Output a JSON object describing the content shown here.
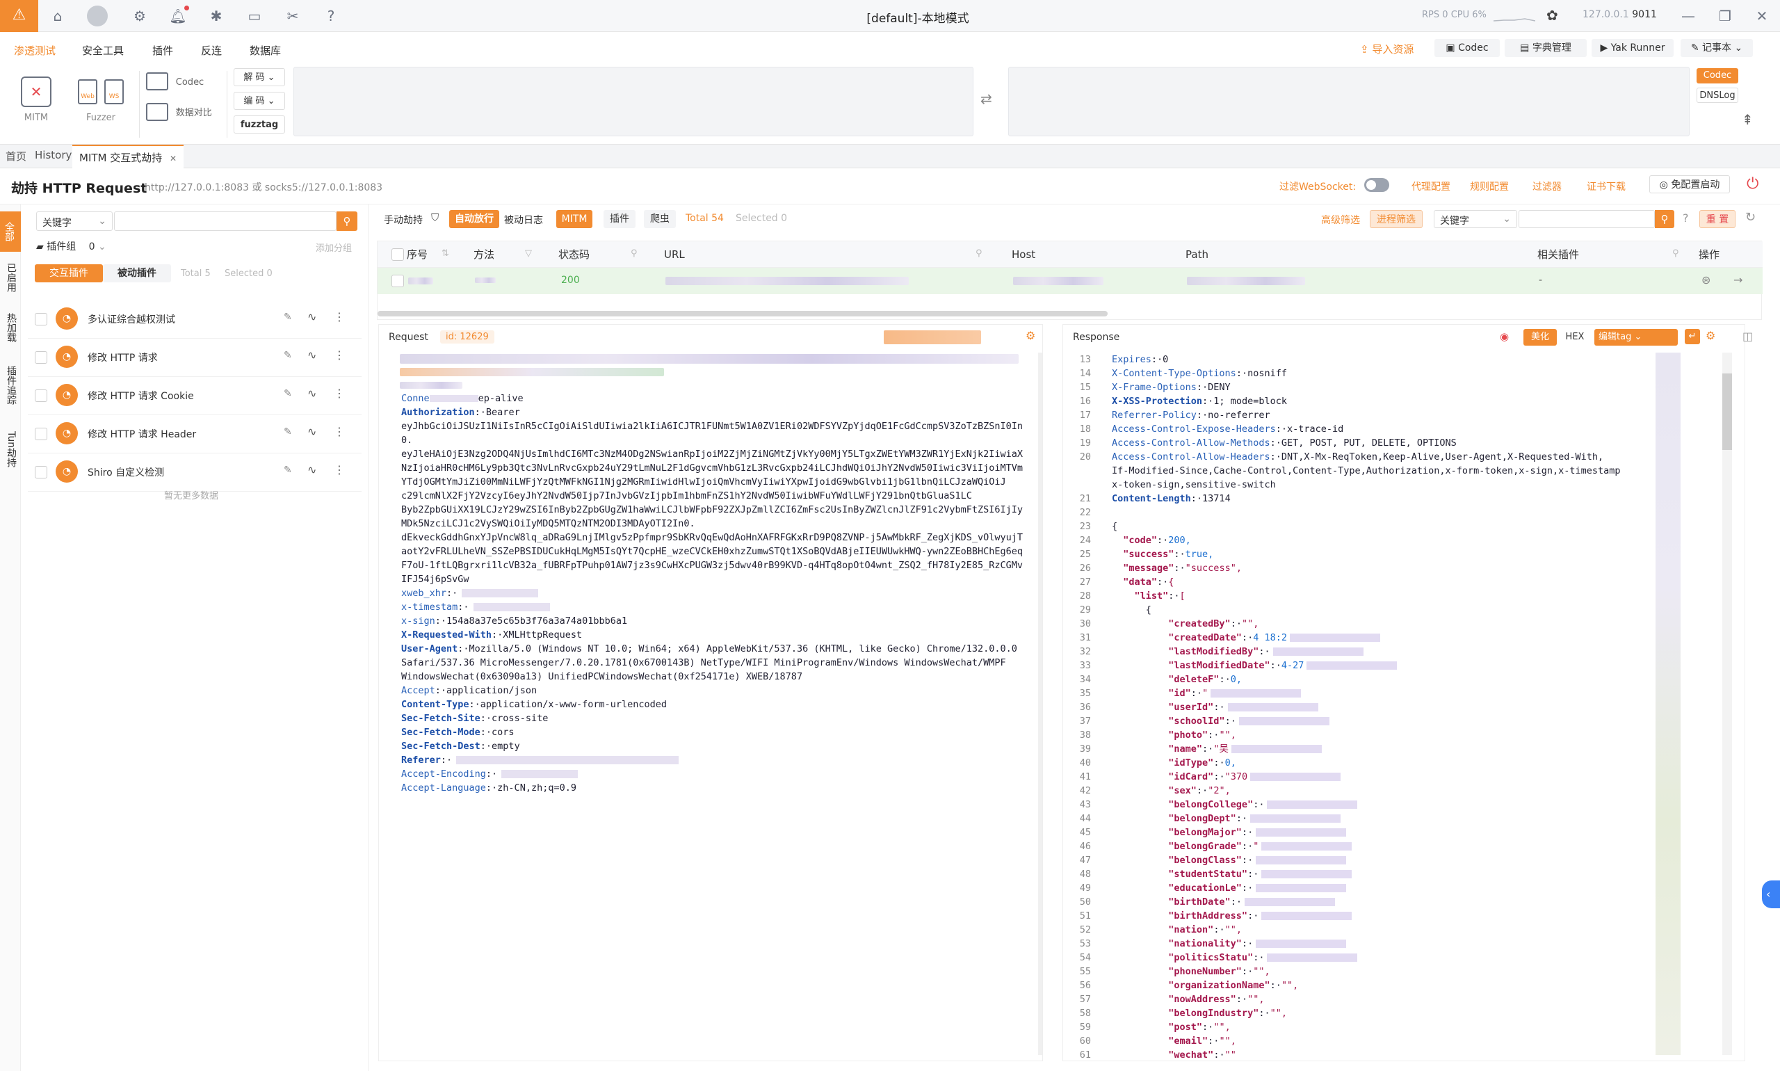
{
  "title": "[default]-本地模式",
  "status": {
    "rps_label": "RPS",
    "rps": "0",
    "cpu_label": "CPU",
    "cpu": "6%",
    "addr": "127.0.0.1",
    "port": "9011"
  },
  "menu": [
    "渗透测试",
    "安全工具",
    "插件",
    "反连",
    "数据库"
  ],
  "right_menu": {
    "import": "导入资源",
    "codec": "Codec",
    "dict": "字典管理",
    "yak": "Yak Runner",
    "notebook": "记事本"
  },
  "tools": {
    "mitm": "MITM",
    "fuzzer": "Fuzzer",
    "codec": "Codec",
    "compare": "数据对比",
    "decode": "解 码",
    "encode": "编 码",
    "fuzztag": "fuzztag",
    "codec_right": "Codec",
    "dnslog": "DNSLog"
  },
  "tabs": [
    "首页",
    "History",
    "MITM 交互式劫持"
  ],
  "header": {
    "title": "劫持 HTTP Request",
    "addr": "http://127.0.0.1:8083 或 socks5://127.0.0.1:8083",
    "filter_ws": "过滤WebSocket:",
    "proxy": "代理配置",
    "rules": "规则配置",
    "filter": "过滤器",
    "cert": "证书下载",
    "autostart": "免配置启动"
  },
  "side_tabs": [
    "全部",
    "已启用",
    "热加载",
    "插件追踪",
    "Tun劫持"
  ],
  "left": {
    "search_mode": "关键字",
    "group_label": "插件组",
    "group_count": "0",
    "add_group": "添加分组",
    "tab_active": "交互插件",
    "tab_passive": "被动插件",
    "total": "Total 5",
    "selected": "Selected 0",
    "empty": "暂无更多数据",
    "plugins": [
      "多认证综合越权测试",
      "修改 HTTP 请求",
      "修改 HTTP 请求 Cookie",
      "修改 HTTP 请求 Header",
      "Shiro 自定义检测"
    ]
  },
  "table": {
    "manual": "手动劫持",
    "auto": "自动放行",
    "log": "被动日志",
    "mitm": "MITM",
    "plugin": "插件",
    "crawler": "爬虫",
    "total": "Total 54",
    "selected": "Selected 0",
    "adv": "高级筛选",
    "proc": "进程筛选",
    "keyword": "关键字",
    "reset": "重 置",
    "cols": [
      "序号",
      "方法",
      "状态码",
      "URL",
      "Host",
      "Path",
      "相关插件",
      "操作"
    ],
    "row_status": "200",
    "row_plugin": "-"
  },
  "request": {
    "label": "Request",
    "id": "id: 12629",
    "lines": [
      [
        "",
        "Conne",
        "ep-alive"
      ],
      [
        "k",
        "Authorization",
        "Bearer"
      ],
      [
        "t",
        "",
        "eyJhbGciOiJSUzI1NiIsInR5cCIgOiAiSldUIiwia2lkIiA6ICJTR1FUNmt5W1A0ZV1ERi02WDFSYVZpYjdqOE1FcGdCcmpSV3ZoTzBZSnI0In"
      ],
      [
        "t",
        "",
        "0."
      ],
      [
        "t",
        "",
        "eyJleHAiOjE3Nzg2ODQ4NjUsImlhdCI6MTc3NzM4ODg2NSwianRpIjoiM2ZjMjZiNGMtZjVkYy00MjY5LTgxZWEtYWM3ZWR1YjExNjk2IiwiaX"
      ],
      [
        "t",
        "",
        "NzIjoiaHR0cHM6Ly9pb3Qtc3NvLnRvcGxpb24uY29tLmNuL2F1dGgvcmVhbG1zL3RvcGxpb24iLCJhdWQiOiJhY2NvdW50Iiwic3ViIjoiMTVm"
      ],
      [
        "t",
        "",
        "YTdjOGMtYmJiZi00MmNiLWFjYzQtMWFkNGI1Njg2MGRmIiwidHlwIjoiQmVhcmVyIiwiYXpwIjoidG9wbGlvbi1jbG1lbnQiLCJzaWQiOiJ"
      ],
      [
        "t",
        "",
        "c29lcmNlX2FjY2VzcyI6eyJhY2NvdW50Ijp7InJvbGVzIjpbIm1hbmFnZS1hY2NvdW50IiwibWFuYWdlLWFjY291bnQtbGluaS1LC"
      ],
      [
        "t",
        "",
        "Byb2ZpbGUiXX19LCJzY29wZSI6InByb2ZpbGUgZW1haWwiLCJlbWFpbF92ZXJpZmllZCI6ZmFsc2UsInByZWZlcnJlZF91c2VybmFtZSI6IjIy"
      ],
      [
        "t",
        "",
        "MDk5NzciLCJ1c2VySWQiOiIyMDQ5MTQzNTM2ODI3MDAyOTI2In0."
      ],
      [
        "t",
        "",
        "dEkveckGddhGnxYJpVncW8lq_aDRaG9LnjIMlgv5zPpfmpr9SbKRvQqEwQdAoHnXAFRFGKxRrD9PQ8ZVNP-j5AwMbkRF_ZegXjKDS_vOlwyujT"
      ],
      [
        "t",
        "",
        "aotY2vFRLULheVN_SSZePBSIDUCukHqLMgM5IsQYt7QcpHE_wzeCVCkEH0xhzZumwSTQt1XSoBQVdABjeIIEUWUwkHWQ-ywn2ZEoBBHChEg6eq"
      ],
      [
        "t",
        "",
        "F7oU-1ftLQBgrxri1lcVB32a_fUBRFpTPuhp01AW7jz3s9CwHXcPUGW3zj5dwv40rB99KVD-q4HTq8opOtO4wnt_ZSQ2_fH78Iy2E85_RzCGMv"
      ],
      [
        "t",
        "",
        "IFJ54j6pSvGw"
      ],
      [
        "n",
        "xweb_xhr",
        ""
      ],
      [
        "n",
        "x-timestam",
        ""
      ],
      [
        "n",
        "x-sign",
        "154a8a37e5c65b3f76a3a74a01bbb6a1"
      ],
      [
        "k",
        "X-Requested-With",
        "XMLHttpRequest"
      ],
      [
        "k",
        "User-Agent",
        "Mozilla/5.0 (Windows NT 10.0; Win64; x64) AppleWebKit/537.36 (KHTML, like Gecko) Chrome/132.0.0.0"
      ],
      [
        "t",
        "",
        "Safari/537.36 MicroMessenger/7.0.20.1781(0x6700143B) NetType/WIFI MiniProgramEnv/Windows WindowsWechat/WMPF"
      ],
      [
        "t",
        "",
        "WindowsWechat(0x63090a13) UnifiedPCWindowsWechat(0xf254171e) XWEB/18787"
      ],
      [
        "n",
        "Accept",
        "application/json"
      ],
      [
        "k",
        "Content-Type",
        "application/x-www-form-urlencoded"
      ],
      [
        "k",
        "Sec-Fetch-Site",
        "cross-site"
      ],
      [
        "k",
        "Sec-Fetch-Mode",
        "cors"
      ],
      [
        "k",
        "Sec-Fetch-Dest",
        "empty"
      ],
      [
        "k",
        "Referer",
        ""
      ],
      [
        "n",
        "Accept-Encoding",
        ""
      ],
      [
        "n",
        "Accept-Language",
        "zh-CN,zh;q=0.9"
      ]
    ]
  },
  "response": {
    "label": "Response",
    "beautify": "美化",
    "hex": "HEX",
    "edit_tag": "编辑tag",
    "lines": [
      [
        "13",
        "h",
        "Expires",
        "0"
      ],
      [
        "14",
        "h",
        "X-Content-Type-Options",
        "nosniff"
      ],
      [
        "15",
        "h",
        "X-Frame-Options",
        "DENY"
      ],
      [
        "16",
        "hb",
        "X-XSS-Protection",
        "1; mode=block"
      ],
      [
        "17",
        "h",
        "Referrer-Policy",
        "no-referrer"
      ],
      [
        "18",
        "h",
        "Access-Control-Expose-Headers",
        "x-trace-id"
      ],
      [
        "19",
        "h",
        "Access-Control-Allow-Methods",
        "GET, POST, PUT, DELETE, OPTIONS"
      ],
      [
        "20",
        "h",
        "Access-Control-Allow-Headers",
        "DNT,X-Mx-ReqToken,Keep-Alive,User-Agent,X-Requested-With,"
      ],
      [
        "",
        "t",
        "",
        "If-Modified-Since,Cache-Control,Content-Type,Authorization,x-form-token,x-sign,x-timestamp"
      ],
      [
        "",
        "t",
        "",
        "x-token-sign,sensitive-switch"
      ],
      [
        "21",
        "hb",
        "Content-Length",
        "13714"
      ],
      [
        "22",
        "t",
        "",
        ""
      ],
      [
        "23",
        "t",
        "",
        "{"
      ],
      [
        "24",
        "j",
        "\"code\"",
        "200,"
      ],
      [
        "25",
        "j",
        "\"success\"",
        "true,"
      ],
      [
        "26",
        "j",
        "\"message\"",
        "\"success\","
      ],
      [
        "27",
        "j",
        "\"data\"",
        "{"
      ],
      [
        "28",
        "j",
        "  \"list\"",
        "["
      ],
      [
        "29",
        "t",
        "",
        "      {"
      ],
      [
        "30",
        "j",
        "        \"createdBy\"",
        "\"\","
      ],
      [
        "31",
        "j",
        "        \"createdDate\"",
        "4 18:2"
      ],
      [
        "32",
        "j",
        "        \"lastModifiedBy\"",
        ""
      ],
      [
        "33",
        "j",
        "        \"lastModifiedDate\"",
        "4-27"
      ],
      [
        "34",
        "j",
        "        \"deleteF\"",
        "0,"
      ],
      [
        "35",
        "j",
        "        \"id\"",
        "\""
      ],
      [
        "36",
        "j",
        "        \"userId\"",
        ""
      ],
      [
        "37",
        "j",
        "        \"schoolId\"",
        ""
      ],
      [
        "38",
        "j",
        "        \"photo\"",
        "\"\","
      ],
      [
        "39",
        "j",
        "        \"name\"",
        "\"吴"
      ],
      [
        "40",
        "j",
        "        \"idType\"",
        "0,"
      ],
      [
        "41",
        "j",
        "        \"idCard\"",
        "\"370"
      ],
      [
        "42",
        "j",
        "        \"sex\"",
        "\"2\","
      ],
      [
        "43",
        "j",
        "        \"belongCollege\"",
        ""
      ],
      [
        "44",
        "j",
        "        \"belongDept\"",
        ""
      ],
      [
        "45",
        "j",
        "        \"belongMajor\"",
        ""
      ],
      [
        "46",
        "j",
        "        \"belongGrade\"",
        "\""
      ],
      [
        "47",
        "j",
        "        \"belongClass\"",
        ""
      ],
      [
        "48",
        "j",
        "        \"studentStatu\"",
        ""
      ],
      [
        "49",
        "j",
        "        \"educationLe\"",
        ""
      ],
      [
        "50",
        "j",
        "        \"birthDate\"",
        ""
      ],
      [
        "51",
        "j",
        "        \"birthAddress\"",
        ""
      ],
      [
        "52",
        "j",
        "        \"nation\"",
        "\"\","
      ],
      [
        "53",
        "j",
        "        \"nationality\"",
        ""
      ],
      [
        "54",
        "j",
        "        \"politicsStatu\"",
        ""
      ],
      [
        "55",
        "j",
        "        \"phoneNumber\"",
        "\"\","
      ],
      [
        "56",
        "j",
        "        \"organizationName\"",
        "\"\","
      ],
      [
        "57",
        "j",
        "        \"nowAddress\"",
        "\"\","
      ],
      [
        "58",
        "j",
        "        \"belongIndustry\"",
        "\"\","
      ],
      [
        "59",
        "j",
        "        \"post\"",
        "\"\","
      ],
      [
        "60",
        "j",
        "        \"email\"",
        "\"\","
      ],
      [
        "61",
        "j",
        "        \"wechat\"",
        "\"\""
      ]
    ]
  }
}
